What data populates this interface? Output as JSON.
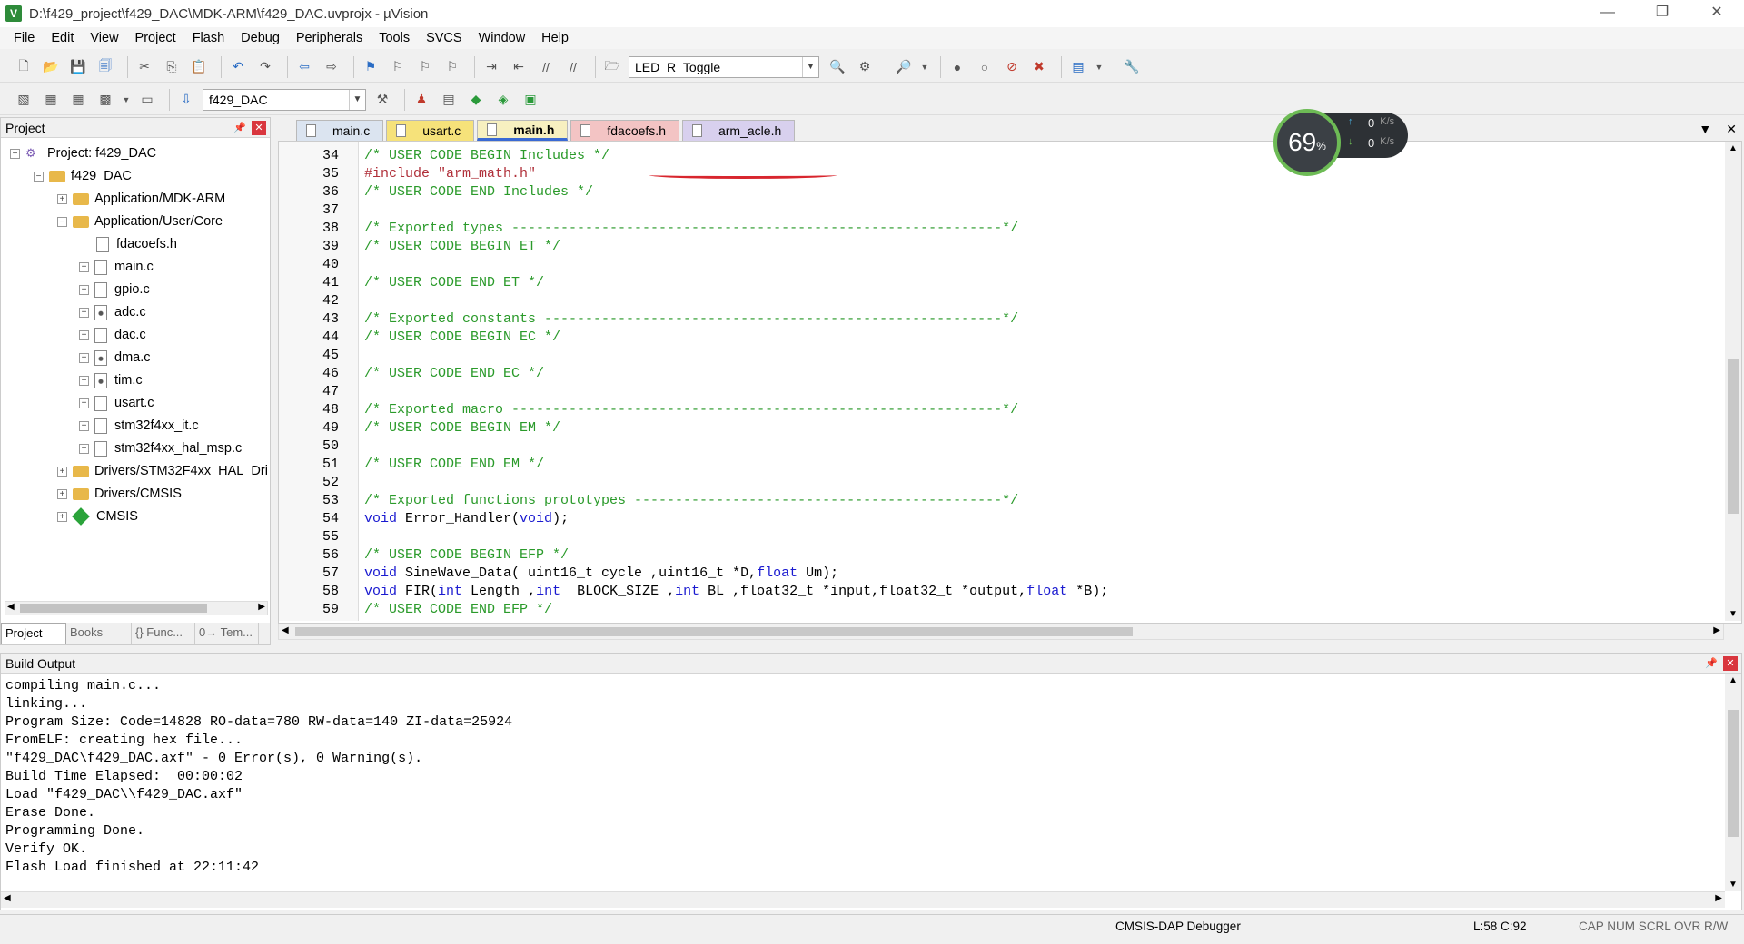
{
  "window": {
    "title": "D:\\f429_project\\f429_DAC\\MDK-ARM\\f429_DAC.uvprojx - µVision",
    "controls": [
      "—",
      "❐",
      "✕"
    ]
  },
  "menu": [
    "File",
    "Edit",
    "View",
    "Project",
    "Flash",
    "Debug",
    "Peripherals",
    "Tools",
    "SVCS",
    "Window",
    "Help"
  ],
  "toolbar": {
    "function_combo": "LED_R_Toggle",
    "target_combo": "f429_DAC"
  },
  "project_panel": {
    "title": "Project",
    "root": "Project: f429_DAC",
    "target": "f429_DAC",
    "folders": [
      "Application/MDK-ARM",
      "Application/User/Core",
      "Drivers/STM32F4xx_HAL_Dri",
      "Drivers/CMSIS",
      "CMSIS"
    ],
    "files": [
      "fdacoefs.h",
      "main.c",
      "gpio.c",
      "adc.c",
      "dac.c",
      "dma.c",
      "tim.c",
      "usart.c",
      "stm32f4xx_it.c",
      "stm32f4xx_hal_msp.c"
    ],
    "tabs": [
      "Project",
      "Books",
      "{} Func...",
      "0→ Tem..."
    ]
  },
  "editor_tabs": [
    "main.c",
    "usart.c",
    "main.h",
    "fdacoefs.h",
    "arm_acle.h"
  ],
  "code_lines": [
    {
      "n": "34",
      "parts": [
        {
          "t": "/* USER CODE BEGIN Includes */",
          "c": "c-green"
        }
      ]
    },
    {
      "n": "35",
      "parts": [
        {
          "t": "#include \"arm_math.h\"",
          "c": "c-red"
        }
      ]
    },
    {
      "n": "36",
      "parts": [
        {
          "t": "/* USER CODE END Includes */",
          "c": "c-green"
        }
      ]
    },
    {
      "n": "37",
      "parts": []
    },
    {
      "n": "38",
      "parts": [
        {
          "t": "/* Exported types ------------------------------------------------------------*/",
          "c": "c-green"
        }
      ]
    },
    {
      "n": "39",
      "parts": [
        {
          "t": "/* USER CODE BEGIN ET */",
          "c": "c-green"
        }
      ]
    },
    {
      "n": "40",
      "parts": []
    },
    {
      "n": "41",
      "parts": [
        {
          "t": "/* USER CODE END ET */",
          "c": "c-green"
        }
      ]
    },
    {
      "n": "42",
      "parts": []
    },
    {
      "n": "43",
      "parts": [
        {
          "t": "/* Exported constants --------------------------------------------------------*/",
          "c": "c-green"
        }
      ]
    },
    {
      "n": "44",
      "parts": [
        {
          "t": "/* USER CODE BEGIN EC */",
          "c": "c-green"
        }
      ]
    },
    {
      "n": "45",
      "parts": []
    },
    {
      "n": "46",
      "parts": [
        {
          "t": "/* USER CODE END EC */",
          "c": "c-green"
        }
      ]
    },
    {
      "n": "47",
      "parts": []
    },
    {
      "n": "48",
      "parts": [
        {
          "t": "/* Exported macro ------------------------------------------------------------*/",
          "c": "c-green"
        }
      ]
    },
    {
      "n": "49",
      "parts": [
        {
          "t": "/* USER CODE BEGIN EM */",
          "c": "c-green"
        }
      ]
    },
    {
      "n": "50",
      "parts": []
    },
    {
      "n": "51",
      "parts": [
        {
          "t": "/* USER CODE END EM */",
          "c": "c-green"
        }
      ]
    },
    {
      "n": "52",
      "parts": []
    },
    {
      "n": "53",
      "parts": [
        {
          "t": "/* Exported functions prototypes ---------------------------------------------*/",
          "c": "c-green"
        }
      ]
    },
    {
      "n": "54",
      "parts": [
        {
          "t": "void",
          "c": "c-blue"
        },
        {
          "t": " Error_Handler(",
          "c": "c-black"
        },
        {
          "t": "void",
          "c": "c-blue"
        },
        {
          "t": ");",
          "c": "c-black"
        }
      ]
    },
    {
      "n": "55",
      "parts": []
    },
    {
      "n": "56",
      "parts": [
        {
          "t": "/* USER CODE BEGIN EFP */",
          "c": "c-green"
        }
      ]
    },
    {
      "n": "57",
      "parts": [
        {
          "t": "void",
          "c": "c-blue"
        },
        {
          "t": " SineWave_Data( uint16_t cycle ,uint16_t *D,",
          "c": "c-black"
        },
        {
          "t": "float",
          "c": "c-blue"
        },
        {
          "t": " Um);",
          "c": "c-black"
        }
      ]
    },
    {
      "n": "58",
      "parts": [
        {
          "t": "void",
          "c": "c-blue"
        },
        {
          "t": " FIR(",
          "c": "c-black"
        },
        {
          "t": "int",
          "c": "c-blue"
        },
        {
          "t": " Length ,",
          "c": "c-black"
        },
        {
          "t": "int",
          "c": "c-blue"
        },
        {
          "t": "  BLOCK_SIZE ,",
          "c": "c-black"
        },
        {
          "t": "int",
          "c": "c-blue"
        },
        {
          "t": " BL ,float32_t *input,float32_t *output,",
          "c": "c-black"
        },
        {
          "t": "float",
          "c": "c-blue"
        },
        {
          "t": " *B);",
          "c": "c-black"
        }
      ]
    },
    {
      "n": "59",
      "parts": [
        {
          "t": "/* USER CODE END EFP */",
          "c": "c-green"
        }
      ]
    }
  ],
  "speed_widget": {
    "percent": "69",
    "percent_unit": "%",
    "upload": "0",
    "download": "0",
    "unit": "K/s"
  },
  "build_output": {
    "title": "Build Output",
    "lines": [
      "compiling main.c...",
      "linking...",
      "Program Size: Code=14828 RO-data=780 RW-data=140 ZI-data=25924",
      "FromELF: creating hex file...",
      "\"f429_DAC\\f429_DAC.axf\" - 0 Error(s), 0 Warning(s).",
      "Build Time Elapsed:  00:00:02",
      "Load \"f429_DAC\\\\f429_DAC.axf\"",
      "Erase Done.",
      "Programming Done.",
      "Verify OK.",
      "Flash Load finished at 22:11:42"
    ]
  },
  "statusbar": {
    "debugger": "CMSIS-DAP Debugger",
    "position": "L:58 C:92",
    "indicators": "CAP  NUM  SCRL  OVR  R/W"
  }
}
